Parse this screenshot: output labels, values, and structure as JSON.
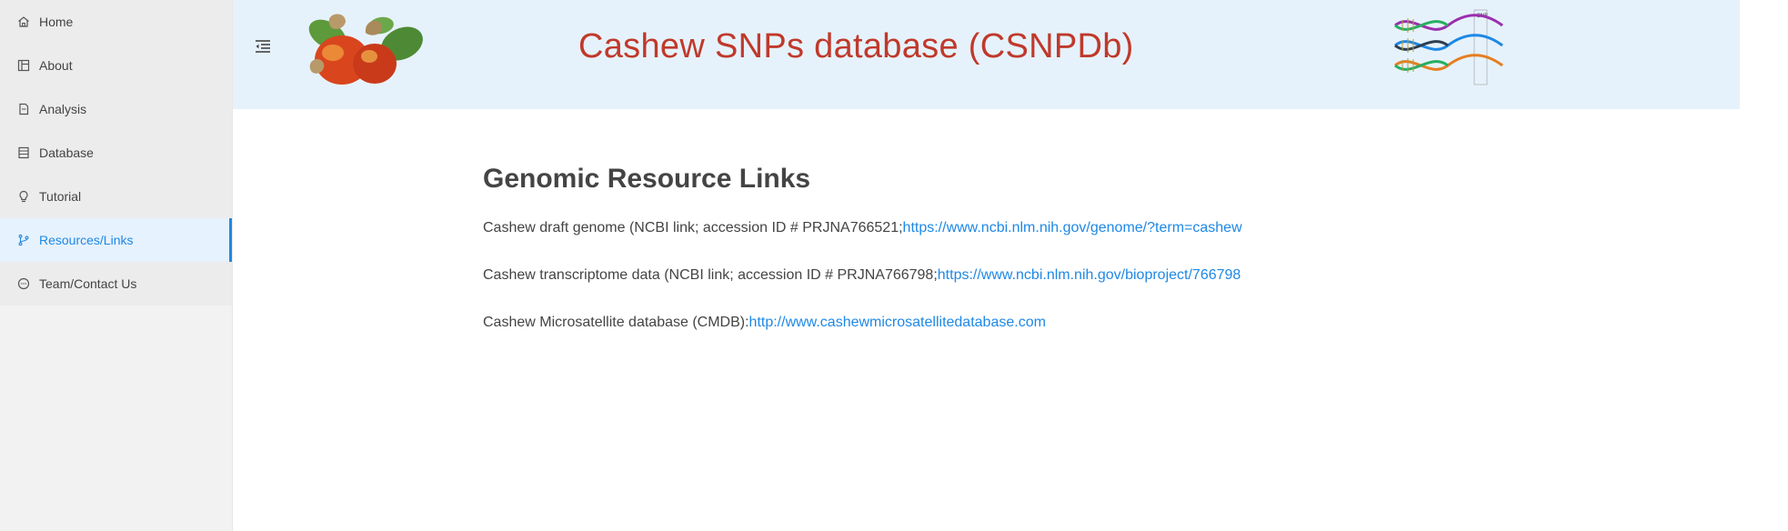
{
  "sidebar": {
    "items": [
      {
        "label": "Home",
        "icon": "home-icon"
      },
      {
        "label": "About",
        "icon": "layout-icon"
      },
      {
        "label": "Analysis",
        "icon": "file-icon"
      },
      {
        "label": "Database",
        "icon": "database-icon"
      },
      {
        "label": "Tutorial",
        "icon": "bulb-icon"
      },
      {
        "label": "Resources/Links",
        "icon": "branch-icon",
        "active": true
      },
      {
        "label": "Team/Contact Us",
        "icon": "message-icon"
      }
    ]
  },
  "header": {
    "title": "Cashew SNPs database (CSNPDb)",
    "title_color": "#c0392b",
    "background_color": "#e6f2fb",
    "logo_right_label": "SNP"
  },
  "main": {
    "heading": "Genomic Resource Links",
    "resources": [
      {
        "text": "Cashew draft genome (NCBI link; accession ID # PRJNA766521;",
        "link": "https://www.ncbi.nlm.nih.gov/genome/?term=cashew"
      },
      {
        "text": "Cashew transcriptome data (NCBI link; accession ID # PRJNA766798;",
        "link": "https://www.ncbi.nlm.nih.gov/bioproject/766798"
      },
      {
        "text": "Cashew Microsatellite database (CMDB):",
        "link": "http://www.cashewmicrosatellitedatabase.com"
      }
    ]
  },
  "colors": {
    "accent": "#1e88e5",
    "active_bg": "#e6f2fd",
    "sidebar_bg": "#f2f2f2"
  }
}
